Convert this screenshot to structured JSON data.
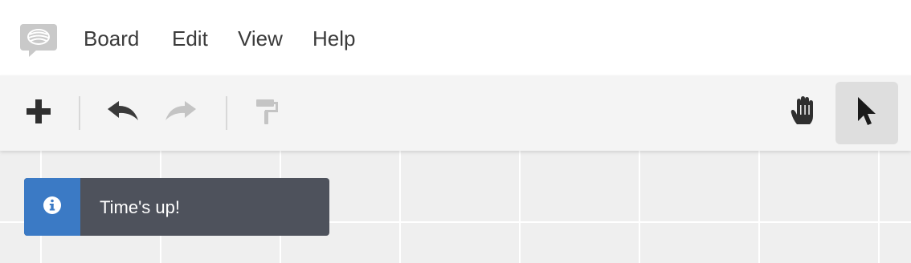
{
  "menu": {
    "items": [
      {
        "label": "Board"
      },
      {
        "label": "Edit"
      },
      {
        "label": "View"
      },
      {
        "label": "Help"
      }
    ]
  },
  "toolbar": {
    "tools": [
      {
        "icon": "plus-icon",
        "state": "enabled"
      },
      {
        "icon": "undo-icon",
        "state": "enabled"
      },
      {
        "icon": "redo-icon",
        "state": "disabled"
      },
      {
        "icon": "paint-roller-icon",
        "state": "disabled"
      },
      {
        "icon": "hand-icon",
        "state": "enabled"
      },
      {
        "icon": "cursor-icon",
        "state": "selected"
      }
    ]
  },
  "toast": {
    "icon": "info-icon",
    "message": "Time's up!"
  },
  "colors": {
    "toast_background": "#4e525c",
    "toast_accent": "#3b7ac5",
    "canvas_background": "#efefef",
    "grid_line": "#ffffff"
  }
}
